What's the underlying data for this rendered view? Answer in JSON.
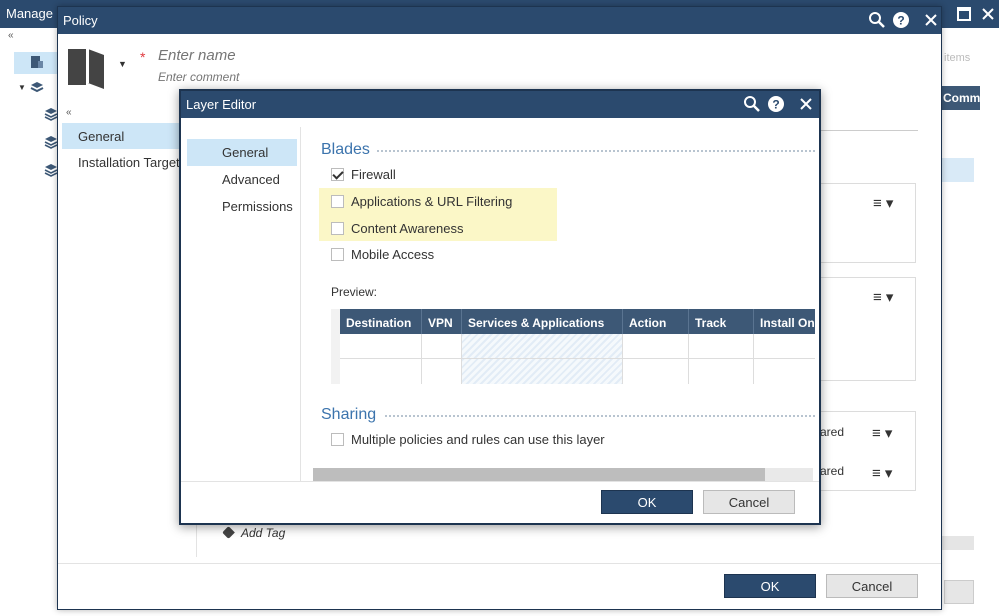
{
  "manage_window": {
    "title": "Manage",
    "items_hint": "items",
    "column_header": "Comm"
  },
  "policy_window": {
    "title": "Policy",
    "name_placeholder": "Enter name",
    "comment_placeholder": "Enter comment",
    "required_mark": "*",
    "collapse_glyph": "«",
    "nav": [
      "General",
      "Installation Targets"
    ],
    "shared_label_1": "ared",
    "shared_label_2": "ared",
    "menu_glyph": "≡ ▾",
    "add_tag": "Add Tag",
    "ok": "OK",
    "cancel": "Cancel"
  },
  "layer_editor": {
    "title": "Layer Editor",
    "nav": [
      "General",
      "Advanced",
      "Permissions"
    ],
    "blades_title": "Blades",
    "blades": [
      {
        "label": "Firewall",
        "checked": true
      },
      {
        "label": "Applications & URL Filtering",
        "checked": false
      },
      {
        "label": "Content Awareness",
        "checked": false
      },
      {
        "label": "Mobile Access",
        "checked": false
      }
    ],
    "preview_label": "Preview:",
    "preview_columns": [
      "Destination",
      "VPN",
      "Services & Applications",
      "Action",
      "Track",
      "Install On"
    ],
    "sharing_title": "Sharing",
    "sharing_option": {
      "label": "Multiple policies and rules can use this layer",
      "checked": false
    },
    "ok": "OK",
    "cancel": "Cancel"
  },
  "colors": {
    "titlebar": "#2b4a6e",
    "selection": "#cde6f7",
    "section_title": "#3c74ad",
    "highlight": "#fbf7c7",
    "table_header": "#3d5876"
  }
}
